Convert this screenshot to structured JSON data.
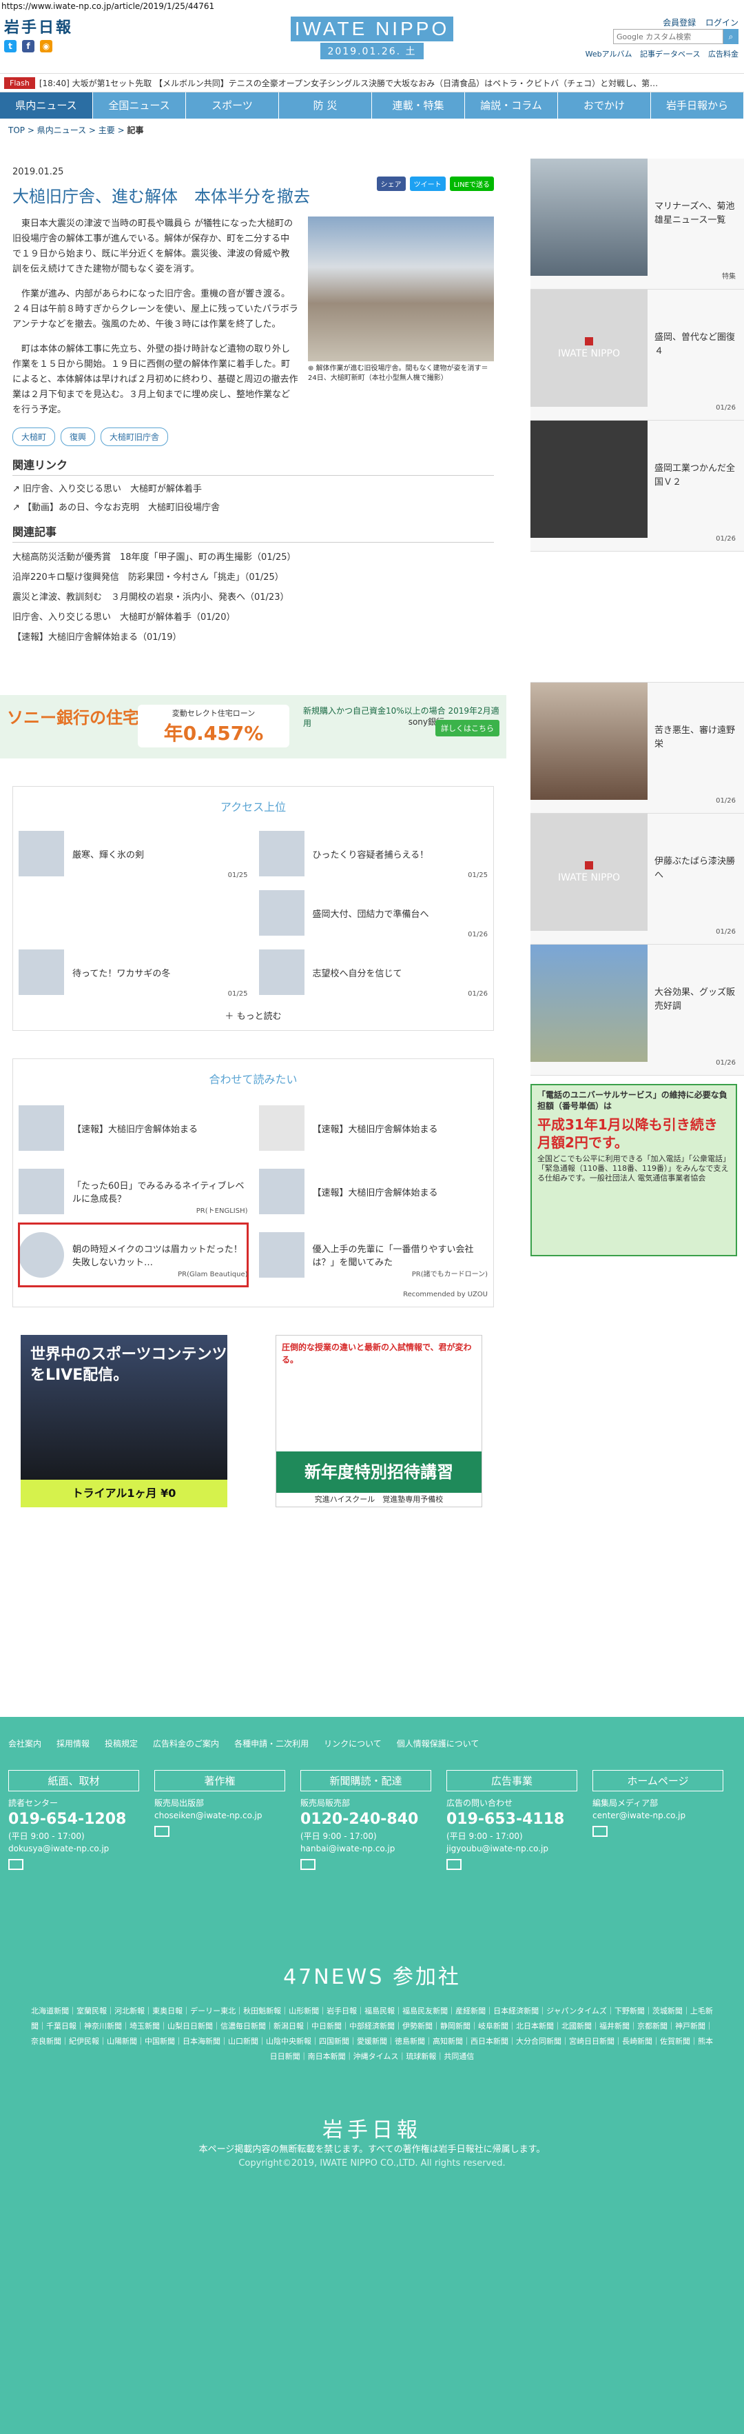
{
  "url": "https://www.iwate-np.co.jp/article/2019/1/25/44761",
  "header": {
    "logo_left": "岩手日報",
    "brand": "IWATE NIPPO",
    "date": "2019.01.26. 土",
    "login_links": [
      "会員登録",
      "ログイン"
    ],
    "search_placeholder": "Google カスタム検索",
    "sublinks": [
      "Webアルバム",
      "記事データベース",
      "広告料金"
    ]
  },
  "flash": {
    "tag": "Flash",
    "text": "[18:40] 大坂が第1セット先取 【メルボルン共同】テニスの全豪オープン女子シングルス決勝で大坂なおみ（日清食品）はペトラ・クビトバ（チェコ）と対戦し、第…"
  },
  "nav": [
    "県内ニュース",
    "全国ニュース",
    "スポーツ",
    "防 災",
    "連載・特集",
    "論説・コラム",
    "おでかけ",
    "岩手日報から"
  ],
  "breadcrumb": {
    "items": [
      "TOP",
      "県内ニュース",
      "主要"
    ],
    "current": "記事"
  },
  "article": {
    "date": "2019.01.25",
    "share": [
      "シェア",
      "ツイート",
      "LINEで送る"
    ],
    "title": "大槌旧庁舎、進む解体　本体半分を撤去",
    "p1": "東日本大震災の津波で当時の町長や職員ら が犠牲になった大槌町の旧役場庁舎の解体工事が進んでいる。解体が保存か、町を二分する中で１９日から始まり、既に半分近くを解体。震災後、津波の脅威や教訓を伝え続けてきた建物が間もなく姿を消す。",
    "p2": "作業が進み、内部があらわになった旧庁舎。重機の音が響き渡る。２４日は午前８時すぎからクレーンを使い、屋上に残っていたパラボラアンテナなどを撤去。強風のため、午後３時には作業を終了した。",
    "p3": "町は本体の解体工事に先立ち、外壁の掛け時計など遺物の取り外し作業を１５日から開始。１９日に西側の壁の解体作業に着手した。町によると、本体解体は早ければ２月初めに終わり、基礎と周辺の撤去作業は２月下旬までを見込む。３月上旬までに埋め戻し、整地作業などを行う予定。",
    "caption": "解体作業が進む旧役場庁舎。間もなく建物が姿を消す＝24日、大槌町新町（本社小型無人機で撮影）",
    "tags": [
      "大槌町",
      "復興",
      "大槌町旧庁舎"
    ]
  },
  "related_links": {
    "heading": "関連リンク",
    "items": [
      "旧庁舎、入り交じる思い　大槌町が解体着手",
      "【動画】あの日、今なお克明　大槌町旧役場庁舎"
    ]
  },
  "related_news": {
    "heading": "関連記事",
    "items": [
      "大槌高防災活動が優秀賞　18年度「甲子園」、町の再生撮影（01/25）",
      "沿岸220キロ駆け復興発信　防彩果団・今村さん「挑走」（01/25）",
      "震災と津波、教訓刻む　３月開校の岩泉・浜内小、発表へ（01/23）",
      "旧庁舎、入り交じる思い　大槌町が解体着手（01/20）",
      "【速報】大槌旧庁舎解体始まる（01/19）"
    ]
  },
  "ad_sony": {
    "t1": "ソニー銀行の住宅ローン",
    "t2a": "変動セレクト住宅ローン",
    "t2b": "年0.457%",
    "t3": "新規購入かつ自己資金10%以上の場合 2019年2月適用",
    "t4": "sony銀行",
    "t5": "詳しくはこちら"
  },
  "access": {
    "heading": "アクセス上位",
    "items": [
      {
        "title": "厳寒、輝く氷の剣",
        "date": "01/25"
      },
      {
        "title": "ひったくり容疑者捕らえる！",
        "date": "01/25"
      },
      {
        "title": "",
        "date": ""
      },
      {
        "title": "盛岡大付、団結力で準備台へ",
        "date": "01/26"
      },
      {
        "title": "待ってた！ワカサギの冬",
        "date": "01/25"
      },
      {
        "title": "志望校へ自分を信じて",
        "date": "01/26"
      }
    ],
    "more": "もっと読む"
  },
  "recommend": {
    "heading": "合わせて読みたい",
    "items": [
      {
        "title": "【速報】大槌旧庁舎解体始まる",
        "pr": ""
      },
      {
        "title": "【速報】大槌旧庁舎解体始まる",
        "pr": ""
      },
      {
        "title": "「たった60日」でみるみるネイティブレベルに急成長？",
        "pr": "PR(トENGLISH)"
      },
      {
        "title": "【速報】大槌旧庁舎解体始まる",
        "pr": ""
      },
      {
        "title": "朝の時短メイクのコツは眉カットだった！失敗しないカット…",
        "pr": "PR(Glam Beautique)"
      },
      {
        "title": "優入上手の先輩に「一番借りやすい会社は？」を聞いてみた",
        "pr": "PR(諸でもカードローン)"
      }
    ],
    "credit": "Recommended by UZOU"
  },
  "ad_dazn": {
    "h": "世界中のスポーツコンテンツをLIVE配信。",
    "b": "トライアル1ヶ月 ¥0"
  },
  "ad_juku": {
    "h": "圧倒的な授業の違いと最新の入試情報で、君が変わる。",
    "b": "新年度特別招待講習",
    "s": "究進ハイスクール　覚進塾専用予備校"
  },
  "sidebar": {
    "items": [
      {
        "title": "マリナーズへ、菊池雄星ニュース一覧",
        "date": "特集"
      },
      {
        "title": "盛岡、曽代など圏復４",
        "date": "01/26"
      },
      {
        "title": "盛岡工業つかんだ全国Ｖ２",
        "date": "01/26"
      },
      {
        "title": "",
        "date": ""
      },
      {
        "title": "苦き悪生、審け遠野栄",
        "date": "01/26"
      },
      {
        "title": "伊藤ぶたばら漆決勝へ",
        "date": "01/26"
      },
      {
        "title": "大谷効果、グッズ販売好調",
        "date": "01/26"
      }
    ],
    "ad": {
      "h": "「電話のユニバーサルサービス」の維持に必要な負担額（番号単価）は",
      "big": "平成31年1月以降も引き続き月額2円です。",
      "s": "全国どこでも公平に利用できる「加入電話」「公衆電話」「緊急通報（110番、118番、119番）」をみんなで支える仕組みです。一般社団法人 電気通信事業者協会"
    }
  },
  "footer": {
    "links": [
      "会社案内",
      "採用情報",
      "投稿規定",
      "広告料金のご案内",
      "各種申請・二次利用",
      "リンクについて",
      "個人情報保護について"
    ],
    "cols": [
      {
        "h": "紙面、取材",
        "sub": "読者センター",
        "ph": "019-654-1208",
        "hr": "(平日 9:00 - 17:00)",
        "mail": "dokusya@iwate-np.co.jp"
      },
      {
        "h": "著作権",
        "sub": "販売局出版部",
        "ph": "",
        "hr": "",
        "mail": "choseiken@iwate-np.co.jp"
      },
      {
        "h": "新聞購読・配達",
        "sub": "販売局販売部",
        "ph": "0120-240-840",
        "hr": "(平日 9:00 - 17:00)",
        "mail": "hanbai@iwate-np.co.jp"
      },
      {
        "h": "広告事業",
        "sub": "広告の問い合わせ",
        "ph": "019-653-4118",
        "hr": "(平日 9:00 - 17:00)",
        "mail": "jigyoubu@iwate-np.co.jp"
      },
      {
        "h": "ホームページ",
        "sub": "編集局メディア部",
        "ph": "",
        "hr": "",
        "mail": "center@iwate-np.co.jp"
      }
    ],
    "news47": "47NEWS 参加社",
    "papers": "北海道新聞｜室蘭民報｜河北新報｜東奥日報｜デーリー東北｜秋田魁新報｜山形新聞｜岩手日報｜福島民報｜福島民友新聞｜産経新聞｜日本経済新聞｜ジャパンタイムズ｜下野新聞｜茨城新聞｜上毛新聞｜千葉日報｜神奈川新聞｜埼玉新聞｜山梨日日新聞｜信濃毎日新聞｜新潟日報｜中日新聞｜中部経済新聞｜伊勢新聞｜静岡新聞｜岐阜新聞｜北日本新聞｜北國新聞｜福井新聞｜京都新聞｜神戸新聞｜奈良新聞｜紀伊民報｜山陽新聞｜中国新聞｜日本海新聞｜山口新聞｜山陰中央新報｜四国新聞｜愛媛新聞｜徳島新聞｜高知新聞｜西日本新聞｜大分合同新聞｜宮崎日日新聞｜長崎新聞｜佐賀新聞｜熊本日日新聞｜南日本新聞｜沖縄タイムス｜琉球新報｜共同通信",
    "logo": "岩手日報",
    "note": "本ページ掲載内容の無断転載を禁じます。すべての著作権は岩手日報社に帰属します。",
    "copyright": "Copyright©2019, IWATE NIPPO CO.,LTD. All rights reserved."
  }
}
